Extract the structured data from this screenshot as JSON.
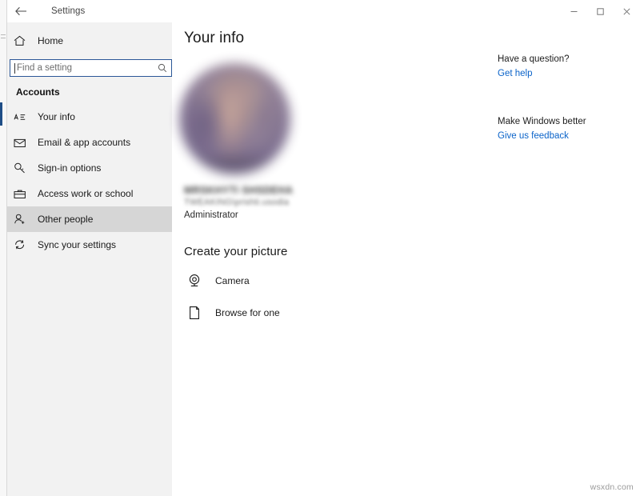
{
  "window": {
    "title": "Settings",
    "back_icon": "back-arrow-icon",
    "controls": {
      "minimize": "minimize-icon",
      "maximize": "maximize-icon",
      "close": "close-icon"
    }
  },
  "sidebar": {
    "home": {
      "label": "Home",
      "icon": "home-icon"
    },
    "search": {
      "placeholder": "Find a setting",
      "value": "",
      "icon": "search-icon"
    },
    "section_header": "Accounts",
    "items": [
      {
        "label": "Your info",
        "icon": "account-info-icon",
        "selected": true,
        "hovered": false
      },
      {
        "label": "Email & app accounts",
        "icon": "envelope-icon",
        "selected": false,
        "hovered": false
      },
      {
        "label": "Sign-in options",
        "icon": "key-icon",
        "selected": false,
        "hovered": false
      },
      {
        "label": "Access work or school",
        "icon": "briefcase-icon",
        "selected": false,
        "hovered": false
      },
      {
        "label": "Other people",
        "icon": "person-add-icon",
        "selected": false,
        "hovered": true
      },
      {
        "label": "Sync your settings",
        "icon": "sync-icon",
        "selected": false,
        "hovered": false
      }
    ]
  },
  "main": {
    "page_title": "Your info",
    "avatar": {
      "icon": "user-avatar-photo",
      "blurred": true
    },
    "identity": {
      "name": "MRSKHYTI SHSDEHA",
      "name_redacted": true,
      "account": "TWEAKING\\prishti.usodia",
      "account_redacted": true,
      "role": "Administrator"
    },
    "create_picture": {
      "title": "Create your picture",
      "options": [
        {
          "label": "Camera",
          "icon": "webcam-icon"
        },
        {
          "label": "Browse for one",
          "icon": "browse-file-icon"
        }
      ]
    }
  },
  "help_pane": {
    "groups": [
      {
        "heading": "Have a question?",
        "link": "Get help"
      },
      {
        "heading": "Make Windows better",
        "link": "Give us feedback"
      }
    ]
  },
  "watermark": "wsxdn.com",
  "colors": {
    "accent": "#1f4e87",
    "link": "#0a63c9",
    "sidebar_bg": "#f2f2f2",
    "hover_bg": "#d6d6d6",
    "search_border": "#2b5797"
  }
}
